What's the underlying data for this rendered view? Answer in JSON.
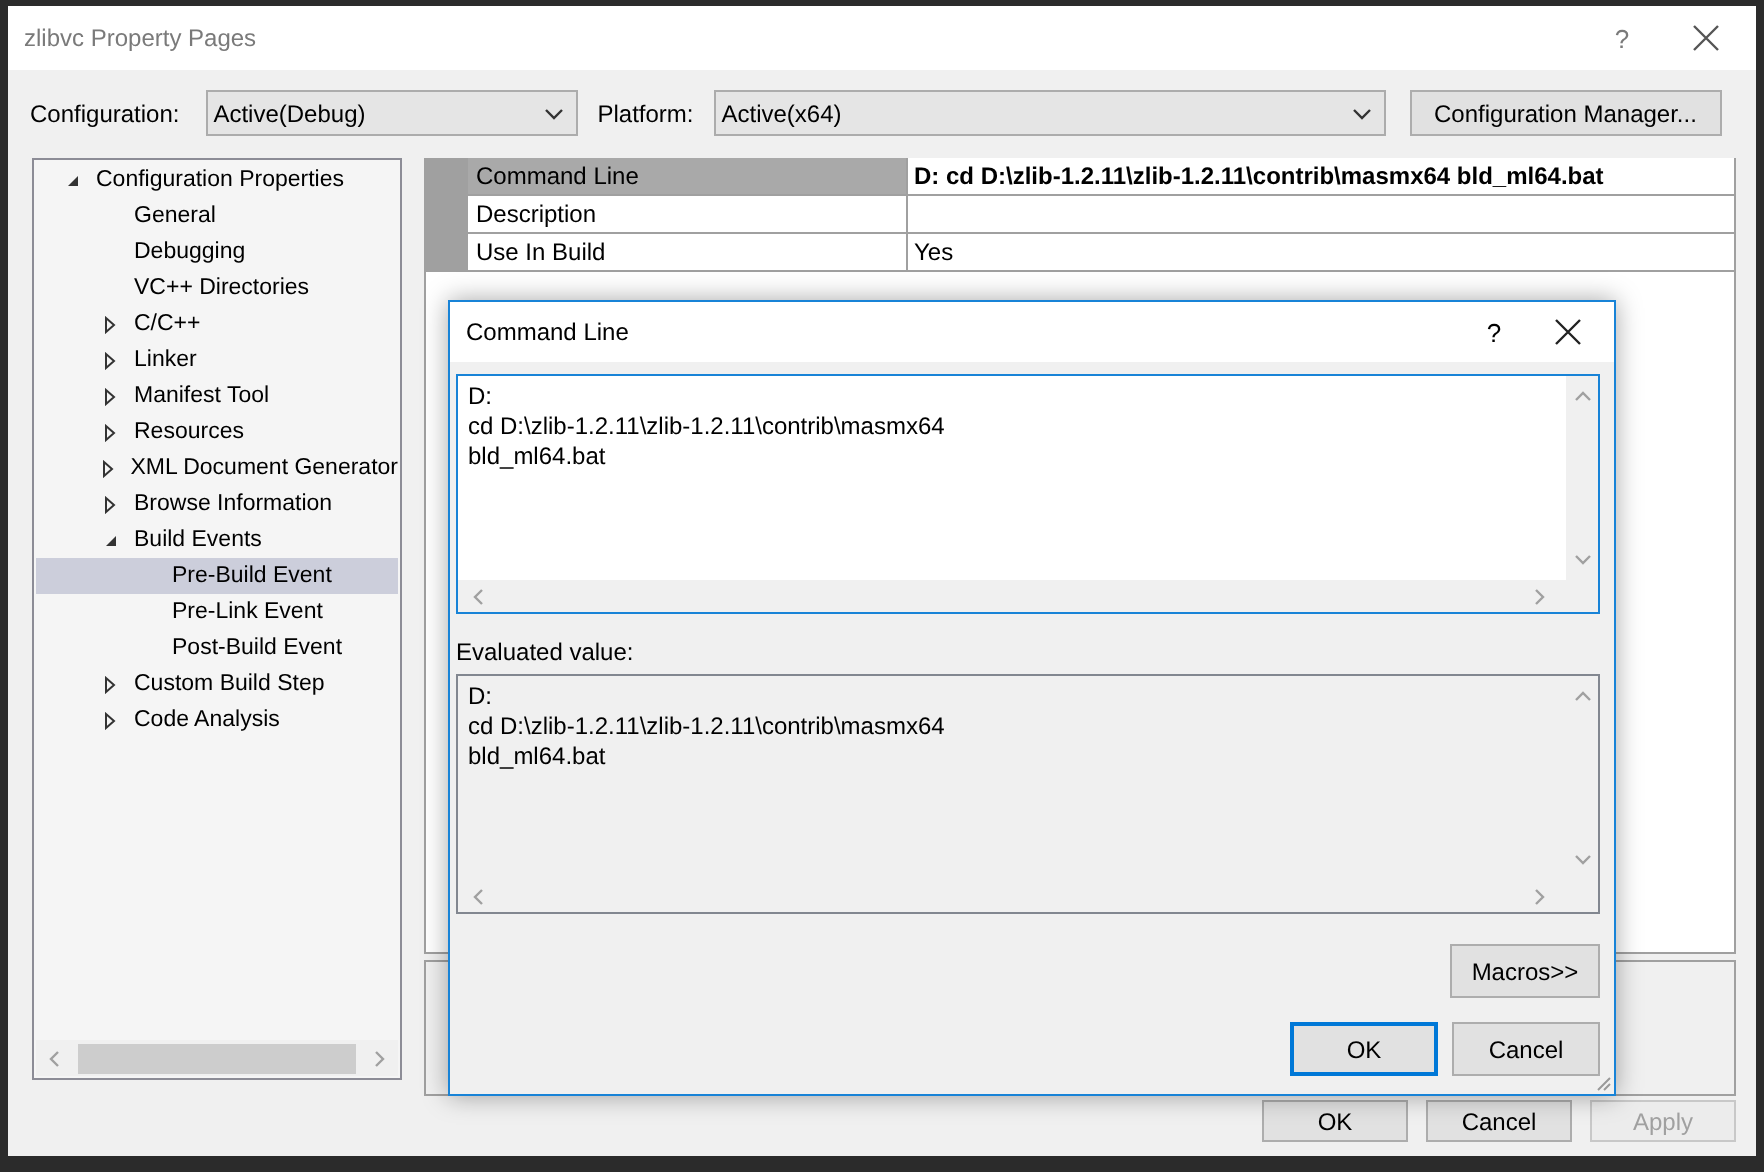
{
  "window": {
    "title": "zlibvc Property Pages",
    "help": "?"
  },
  "toolbar": {
    "configuration": {
      "label": "Configuration:",
      "value": "Active(Debug)"
    },
    "platform": {
      "label": "Platform:",
      "value": "Active(x64)"
    },
    "manager_button": "Configuration Manager..."
  },
  "tree": [
    {
      "label": "Configuration Properties",
      "kind": "folder",
      "expanded": true,
      "selected": false,
      "children": [
        {
          "label": "General",
          "kind": "page",
          "selected": false
        },
        {
          "label": "Debugging",
          "kind": "page",
          "selected": false
        },
        {
          "label": "VC++ Directories",
          "kind": "page",
          "selected": false
        },
        {
          "label": "C/C++",
          "kind": "folder",
          "expanded": false,
          "selected": false
        },
        {
          "label": "Linker",
          "kind": "folder",
          "expanded": false,
          "selected": false
        },
        {
          "label": "Manifest Tool",
          "kind": "folder",
          "expanded": false,
          "selected": false
        },
        {
          "label": "Resources",
          "kind": "folder",
          "expanded": false,
          "selected": false
        },
        {
          "label": "XML Document Generator",
          "kind": "folder",
          "expanded": false,
          "selected": false
        },
        {
          "label": "Browse Information",
          "kind": "folder",
          "expanded": false,
          "selected": false
        },
        {
          "label": "Build Events",
          "kind": "folder",
          "expanded": true,
          "selected": false,
          "children": [
            {
              "label": "Pre-Build Event",
              "kind": "page",
              "selected": true
            },
            {
              "label": "Pre-Link Event",
              "kind": "page",
              "selected": false
            },
            {
              "label": "Post-Build Event",
              "kind": "page",
              "selected": false
            }
          ]
        },
        {
          "label": "Custom Build Step",
          "kind": "folder",
          "expanded": false,
          "selected": false
        },
        {
          "label": "Code Analysis",
          "kind": "folder",
          "expanded": false,
          "selected": false
        }
      ]
    }
  ],
  "grid": {
    "rows": [
      {
        "name": "Command Line",
        "value": "D: cd D:\\zlib-1.2.11\\zlib-1.2.11\\contrib\\masmx64 bld_ml64.bat",
        "selected": true
      },
      {
        "name": "Description",
        "selected": false
      },
      {
        "name": "Use In Build",
        "value": "Yes",
        "selected": false
      }
    ]
  },
  "buttons": [
    {
      "label": "OK",
      "disabled": false
    },
    {
      "label": "Cancel",
      "disabled": false
    },
    {
      "label": "Apply",
      "disabled": true
    }
  ],
  "dialog": {
    "title": "Command Line",
    "help": "?",
    "editor": {
      "lines": [
        "D:",
        "cd D:\\zlib-1.2.11\\zlib-1.2.11\\contrib\\masmx64",
        "bld_ml64.bat"
      ]
    },
    "evaluated_label": "Evaluated value:",
    "evaluated": {
      "lines": [
        "D:",
        "cd D:\\zlib-1.2.11\\zlib-1.2.11\\contrib\\masmx64",
        "bld_ml64.bat"
      ]
    },
    "macros_button": "Macros>>",
    "buttons": [
      {
        "label": "OK",
        "default": true
      },
      {
        "label": "Cancel",
        "default": false
      }
    ]
  }
}
